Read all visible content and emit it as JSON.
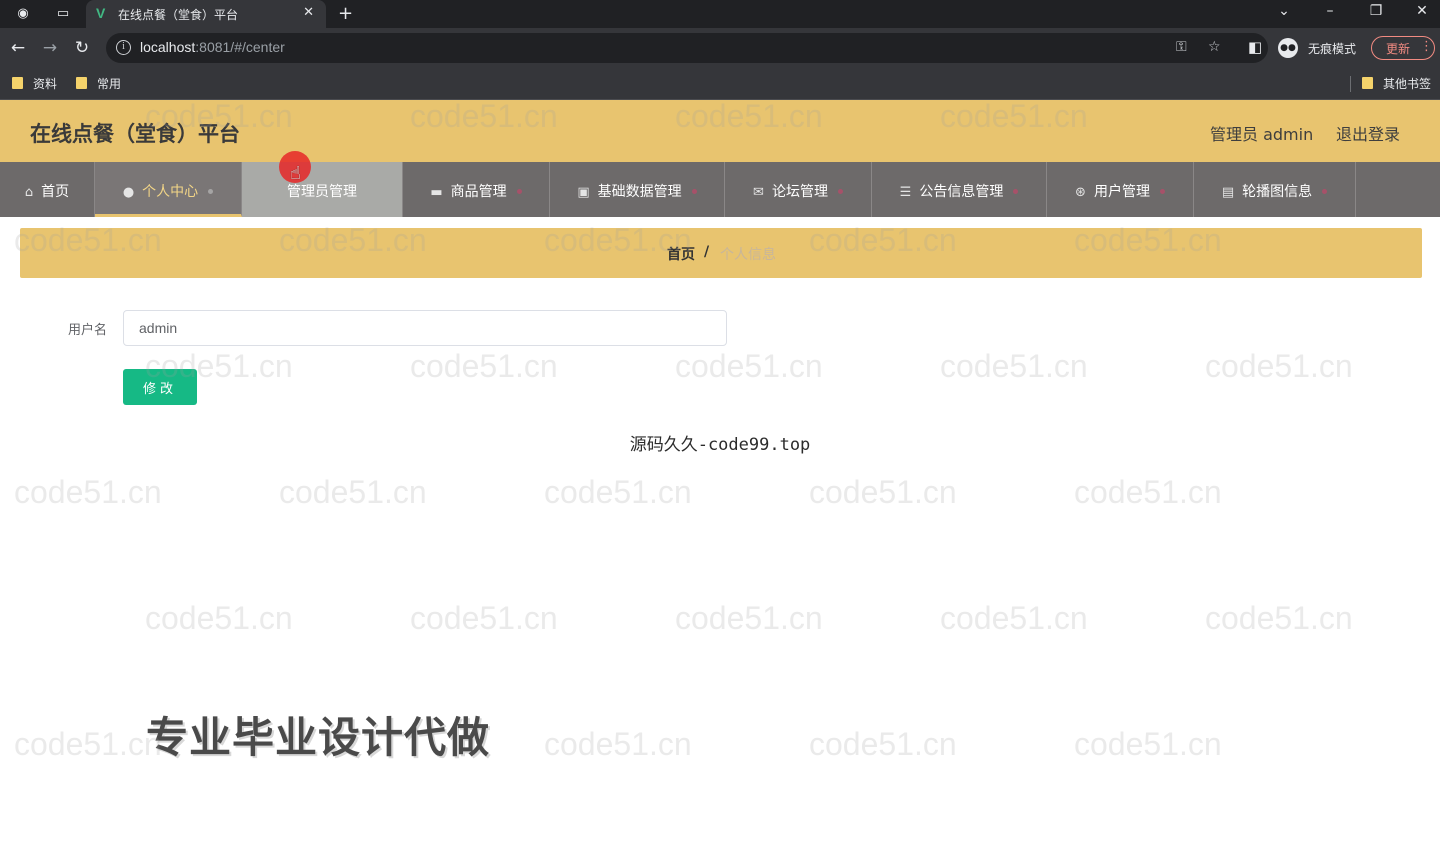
{
  "browser": {
    "tab_title": "在线点餐（堂食）平台",
    "url_host": "localhost",
    "url_rest": ":8081/#/center",
    "incognito_label": "无痕模式",
    "update_label": "更新",
    "bookmarks": [
      "资料",
      "常用"
    ],
    "other_bookmarks": "其他书签"
  },
  "header": {
    "title": "在线点餐（堂食）平台",
    "admin_label": "管理员 admin",
    "logout_label": "退出登录"
  },
  "menu": [
    {
      "label": "首页",
      "icon": "home-icon"
    },
    {
      "label": "个人中心",
      "icon": "user-icon"
    },
    {
      "label": "管理员管理",
      "icon": "admin-icon"
    },
    {
      "label": "商品管理",
      "icon": "product-icon"
    },
    {
      "label": "基础数据管理",
      "icon": "data-icon"
    },
    {
      "label": "论坛管理",
      "icon": "forum-icon"
    },
    {
      "label": "公告信息管理",
      "icon": "notice-icon"
    },
    {
      "label": "用户管理",
      "icon": "users-icon"
    },
    {
      "label": "轮播图信息",
      "icon": "carousel-icon"
    }
  ],
  "breadcrumb": {
    "home": "首页",
    "separator": "/",
    "current": "个人信息"
  },
  "form": {
    "username_label": "用户名",
    "username_value": "admin",
    "submit_label": "修改"
  },
  "overlay": {
    "caption": "源码久久-code99.top",
    "promo": "专业毕业设计代做",
    "watermark": "code51.cn"
  },
  "colors": {
    "header_bg": "#e8c46f",
    "menu_bg": "#6d6a6a",
    "button_green": "#16b985"
  }
}
